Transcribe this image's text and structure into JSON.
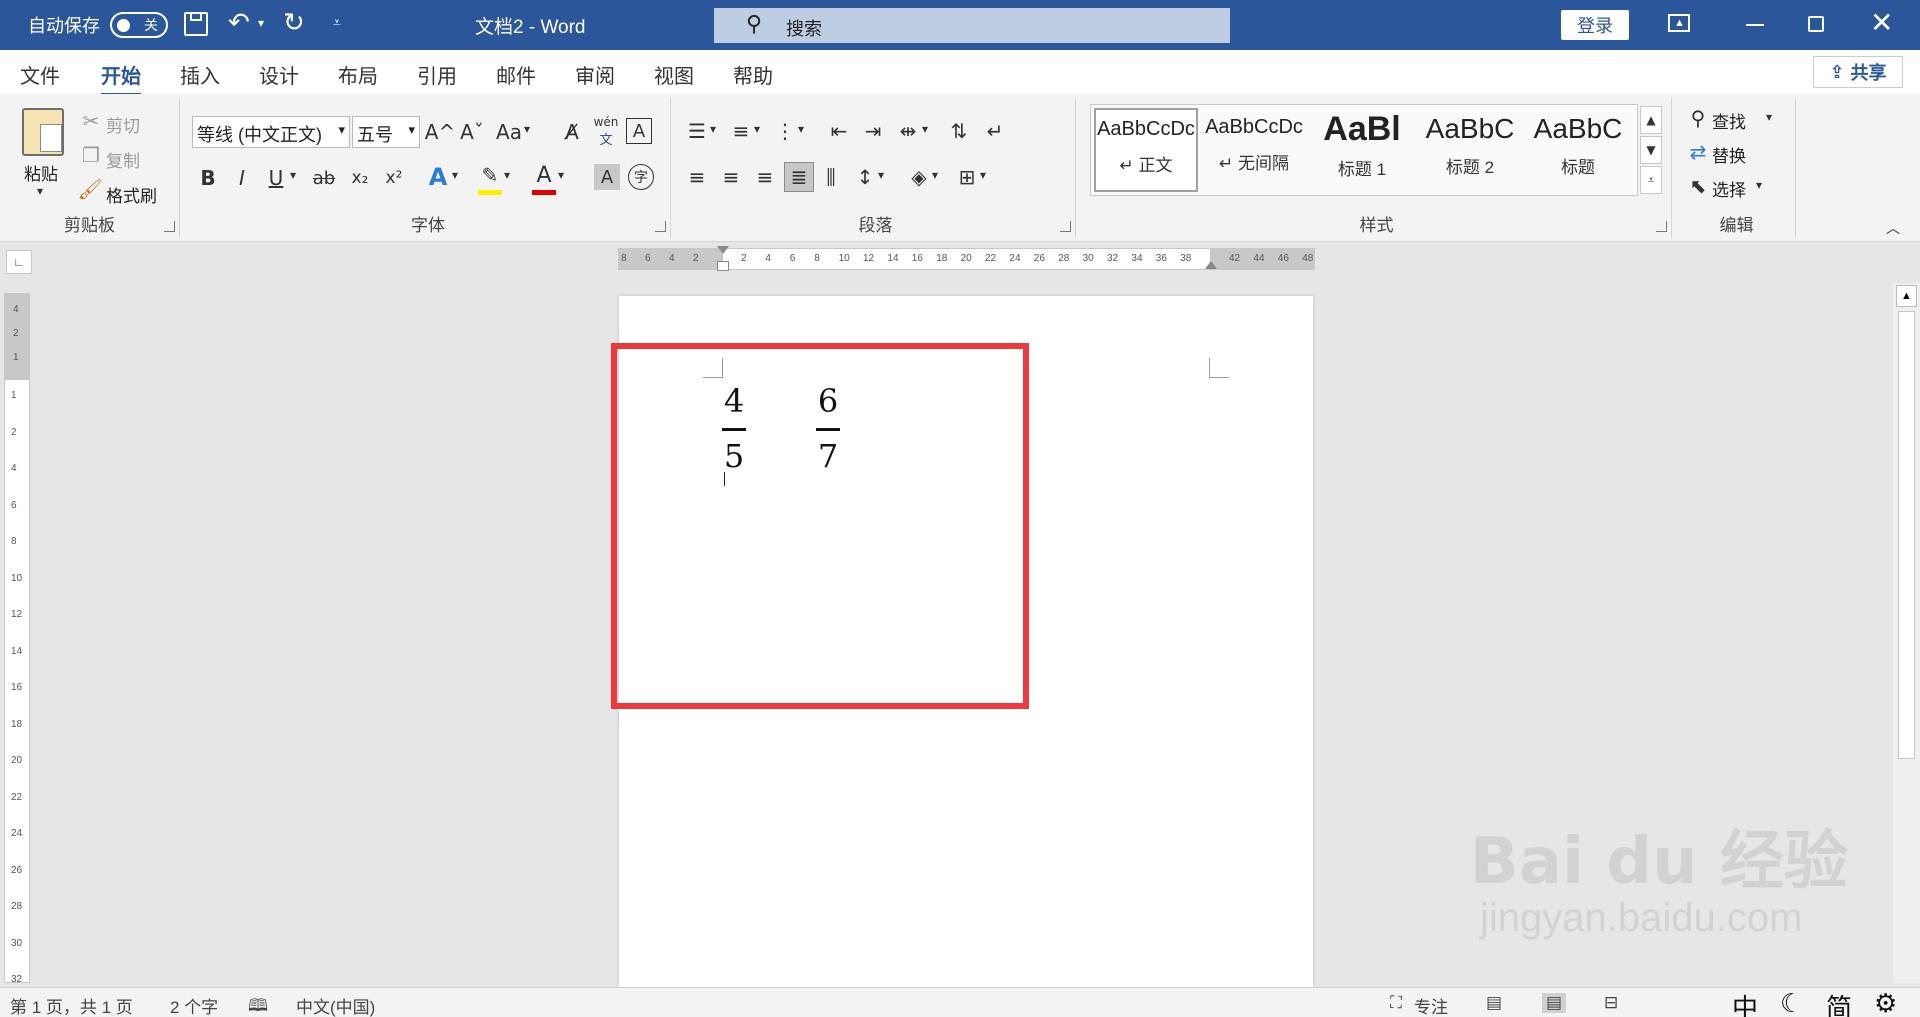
{
  "titlebar": {
    "autosave_label": "自动保存",
    "autosave_state": "关",
    "doc_title": "文档2  -  Word",
    "search_placeholder": "搜索",
    "login_label": "登录"
  },
  "tabs": [
    "文件",
    "开始",
    "插入",
    "设计",
    "布局",
    "引用",
    "邮件",
    "审阅",
    "视图",
    "帮助"
  ],
  "active_tab": "开始",
  "share_label": "共享",
  "clipboard": {
    "paste_label": "粘贴",
    "cut_label": "剪切",
    "copy_label": "复制",
    "format_painter_label": "格式刷",
    "group_label": "剪贴板"
  },
  "font": {
    "font_name": "等线 (中文正文)",
    "font_size": "五号",
    "grow_label": "A^",
    "shrink_label": "Aˇ",
    "case_label": "Aa",
    "phonetic_top": "wén",
    "phonetic_bottom": "文",
    "bold": "B",
    "italic": "I",
    "underline": "U",
    "strike": "ab",
    "subscript": "x₂",
    "superscript": "x²",
    "group_label": "字体",
    "enclose_label": "字"
  },
  "paragraph": {
    "group_label": "段落"
  },
  "styles": {
    "items": [
      {
        "sample": "AaBbCcDc",
        "name": "↵ 正文"
      },
      {
        "sample": "AaBbCcDc",
        "name": "↵ 无间隔"
      },
      {
        "sample": "AaBl",
        "name": "标题 1"
      },
      {
        "sample": "AaBbC",
        "name": "标题 2"
      },
      {
        "sample": "AaBbC",
        "name": "标题"
      }
    ],
    "group_label": "样式"
  },
  "editing": {
    "find_label": "查找",
    "replace_label": "替换",
    "select_label": "选择",
    "group_label": "编辑"
  },
  "ruler": {
    "h_left": [
      "8",
      "6",
      "4",
      "2"
    ],
    "h_right": [
      "2",
      "4",
      "6",
      "8",
      "10",
      "12",
      "14",
      "16",
      "18",
      "20",
      "22",
      "24",
      "26",
      "28",
      "30",
      "32",
      "34",
      "36",
      "38",
      "42",
      "44",
      "46",
      "48"
    ],
    "v_top": [
      "4",
      "2",
      "1"
    ],
    "v": [
      "1",
      "2",
      "4",
      "6",
      "8",
      "10",
      "12",
      "14",
      "16",
      "18",
      "20",
      "22",
      "24",
      "26",
      "28",
      "30",
      "32"
    ]
  },
  "document": {
    "fractions": [
      {
        "numerator": "4",
        "denominator": "5"
      },
      {
        "numerator": "6",
        "denominator": "7"
      }
    ]
  },
  "statusbar": {
    "page_info": "第 1 页，共 1 页",
    "word_count": "2 个字",
    "language": "中文(中国)",
    "focus_label": "专注",
    "ime_mode": "中",
    "ime_lang": "简"
  },
  "watermark": {
    "brand": "Bai du 经验",
    "url": "jingyan.baidu.com"
  },
  "colors": {
    "title_bg": "#2b579a",
    "highlight_border": "#ee3a3f",
    "font_color_bar": "#e00000",
    "highlight_color_bar": "#ffee00"
  },
  "icons": [
    "save-icon",
    "undo-icon",
    "redo-icon",
    "search-icon",
    "ribbon-display-icon",
    "restore-icon",
    "close-icon",
    "share-icon",
    "paste-icon",
    "scissors-icon",
    "copy-icon",
    "format-painter-icon",
    "bullets-icon",
    "numbering-icon",
    "find-icon",
    "replace-icon",
    "select-icon",
    "read-mode-icon",
    "print-layout-icon",
    "web-layout-icon",
    "moon-icon",
    "settings-icon"
  ]
}
